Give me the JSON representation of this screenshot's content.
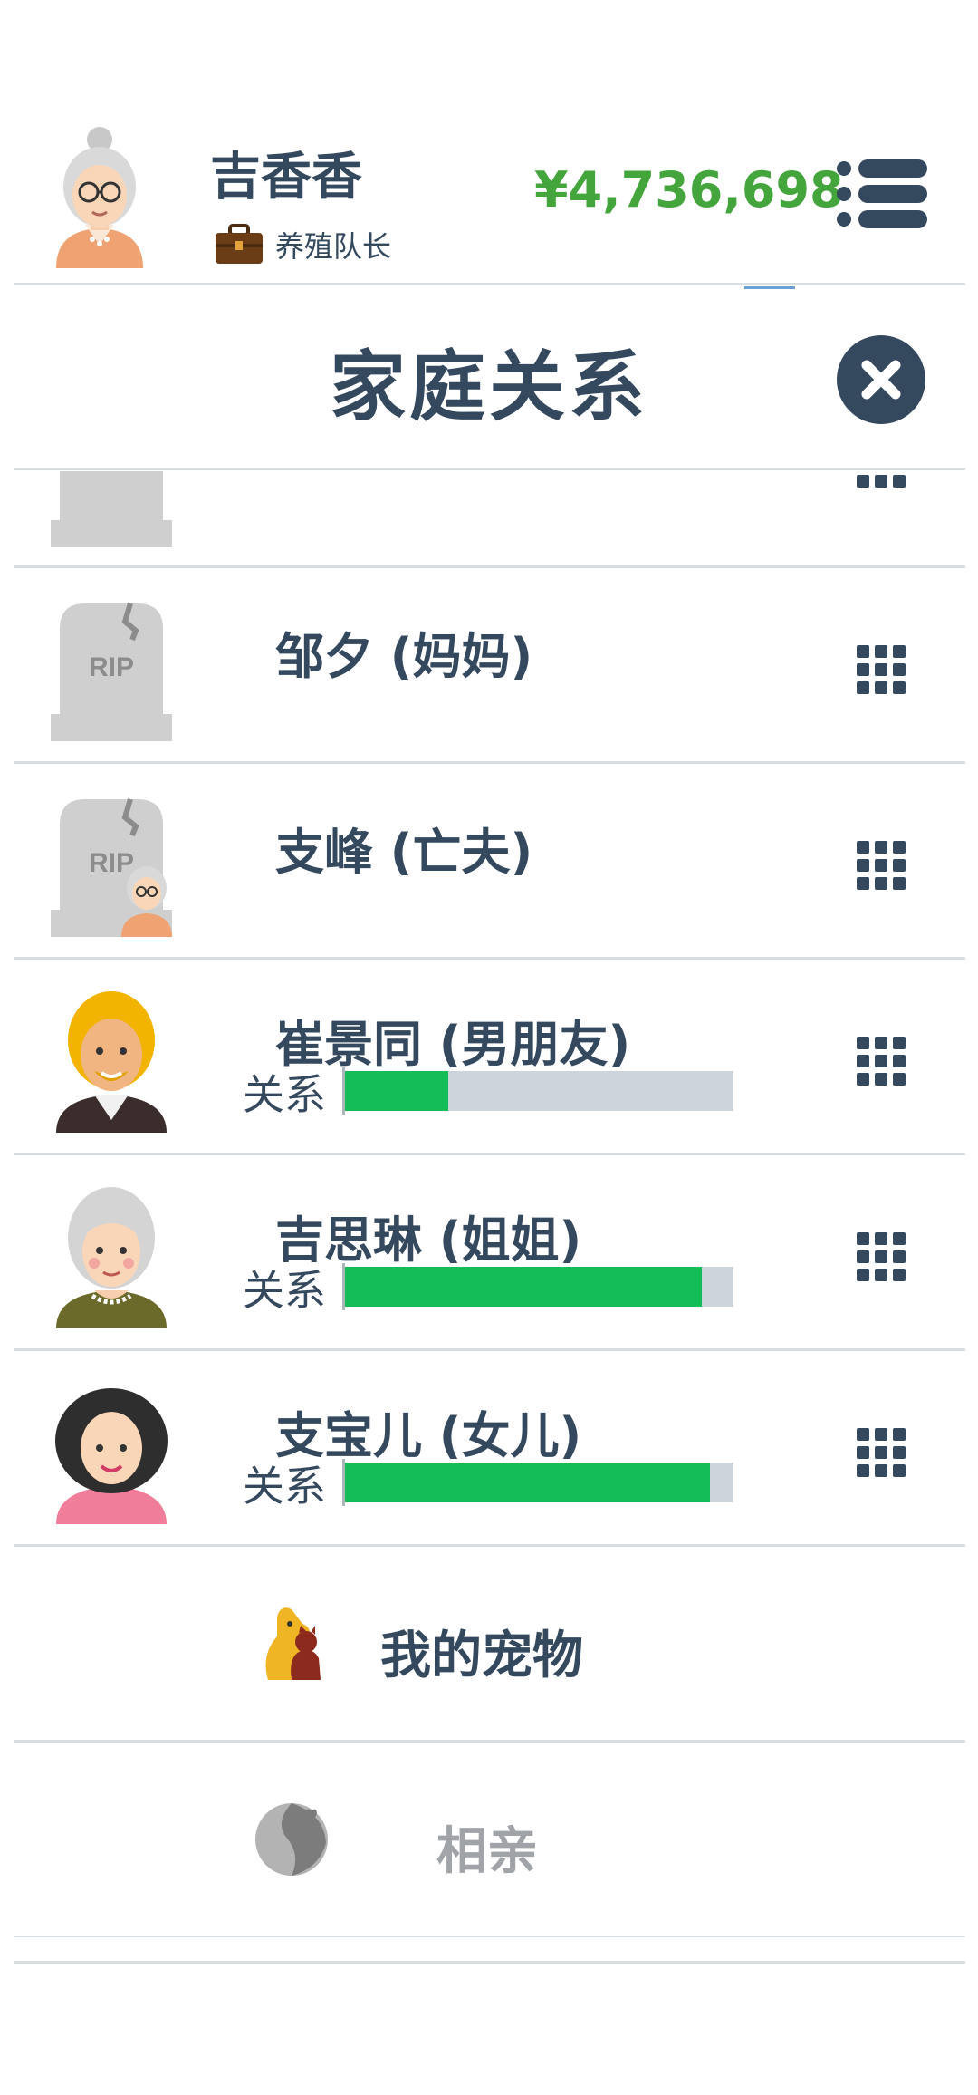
{
  "header": {
    "name": "吉香香",
    "job_title": "养殖队长",
    "money": "¥4,736,698"
  },
  "modal": {
    "title": "家庭关系"
  },
  "relationship_label": "关系",
  "family": [
    {
      "name": "邹夕 (妈妈)",
      "status": "deceased",
      "icon": "tombstone-rip-icon"
    },
    {
      "name": "支峰 (亡夫)",
      "status": "deceased",
      "icon": "tombstone-rip-with-avatar-icon"
    },
    {
      "name": "崔景同 (男朋友)",
      "status": "alive",
      "relationship": 0.27,
      "icon": "blond-man-avatar-icon"
    },
    {
      "name": "吉思琳 (姐姐)",
      "status": "alive",
      "relationship": 0.92,
      "icon": "gray-haired-woman-avatar-icon"
    },
    {
      "name": "支宝儿 (女儿)",
      "status": "alive",
      "relationship": 0.94,
      "icon": "dark-haired-woman-avatar-icon"
    }
  ],
  "actions": [
    {
      "label": "我的宠物",
      "icon": "pet-dog-icon",
      "enabled": true
    },
    {
      "label": "相亲",
      "icon": "matchmaking-icon",
      "enabled": false
    }
  ],
  "colors": {
    "text": "#34495e",
    "money": "#44a53c",
    "bar_fill": "#14bd57",
    "bar_bg": "#cdd4db",
    "disabled": "#a0a4a8"
  },
  "icons": {
    "avatar": "elderly-woman-avatar-icon",
    "job": "briefcase-icon",
    "menu": "menu-icon",
    "close": "close-icon",
    "row_menu": "grid-menu-icon"
  }
}
